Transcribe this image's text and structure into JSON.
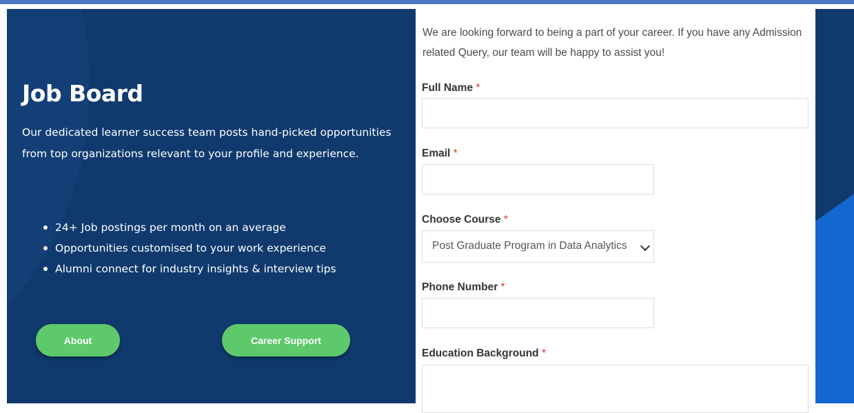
{
  "hero": {
    "title": "Job Board",
    "description": "Our dedicated learner success team posts hand-picked opportunities from top organizations relevant to your profile and experience.",
    "bullets": [
      "24+ Job postings per month on an average",
      "Opportunities customised to your work experience",
      "Alumni connect for industry insights & interview tips"
    ],
    "buttons": {
      "about": "About",
      "career_support": "Career Support"
    }
  },
  "form": {
    "intro": "We are looking forward to being a part of your career. If you have any Admission related Query, our team will be happy to assist you!",
    "required_mark": "*",
    "fields": {
      "full_name": {
        "label": "Full Name",
        "value": ""
      },
      "email": {
        "label": "Email",
        "value": ""
      },
      "course": {
        "label": "Choose Course",
        "selected": "Post Graduate Program in Data Analytics"
      },
      "phone": {
        "label": "Phone Number",
        "value": ""
      },
      "education": {
        "label": "Education Background",
        "value": ""
      }
    }
  },
  "colors": {
    "panel_bg": "#103a6e",
    "button_green": "#5ec96a",
    "accent_blue": "#1466d0",
    "required_red": "#d9342b",
    "top_rule": "#4a78c2"
  },
  "icons": {
    "select_chevron": "chevron-down-icon",
    "bullet": "bullet-dot"
  }
}
